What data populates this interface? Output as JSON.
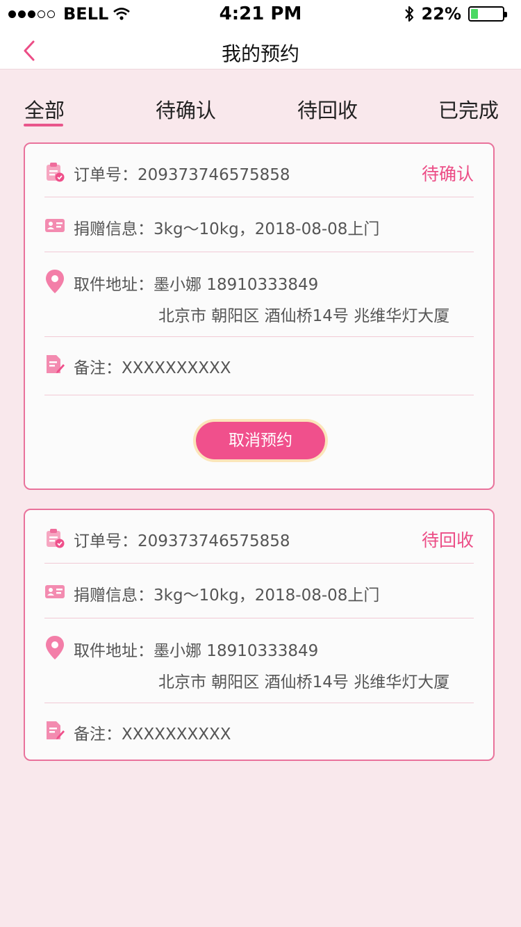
{
  "status_bar": {
    "carrier": "BELL",
    "time": "4:21 PM",
    "battery": "22%",
    "battery_level": 0.22
  },
  "header": {
    "title": "我的预约",
    "back_icon": "chevron-left-icon"
  },
  "tabs": [
    {
      "label": "全部",
      "active": true
    },
    {
      "label": "待确认",
      "active": false
    },
    {
      "label": "待回收",
      "active": false
    },
    {
      "label": "已完成",
      "active": false
    }
  ],
  "orders": [
    {
      "order_label": "订单号：",
      "order_number": "209373746575858",
      "status": "待确认",
      "donation_label": "捐赠信息：",
      "donation_info": "3kg～10kg，2018-08-08上门",
      "address_label": "取件地址：",
      "contact": "墨小娜 18910333849",
      "address": "北京市 朝阳区 酒仙桥14号 兆维华灯大厦",
      "remark_label": "备注：",
      "remark": "XXXXXXXXXX",
      "action_label": "取消预约"
    },
    {
      "order_label": "订单号：",
      "order_number": "209373746575858",
      "status": "待回收",
      "donation_label": "捐赠信息：",
      "donation_info": "3kg～10kg，2018-08-08上门",
      "address_label": "取件地址：",
      "contact": "墨小娜 18910333849",
      "address": "北京市 朝阳区 酒仙桥14号 兆维华灯大厦",
      "remark_label": "备注：",
      "remark": "XXXXXXXXXX"
    }
  ],
  "colors": {
    "accent": "#ec4d86",
    "background": "#f9e8ec",
    "card_border": "#e9729b",
    "button": "#f0508c",
    "button_ring": "#fbe5ba"
  }
}
